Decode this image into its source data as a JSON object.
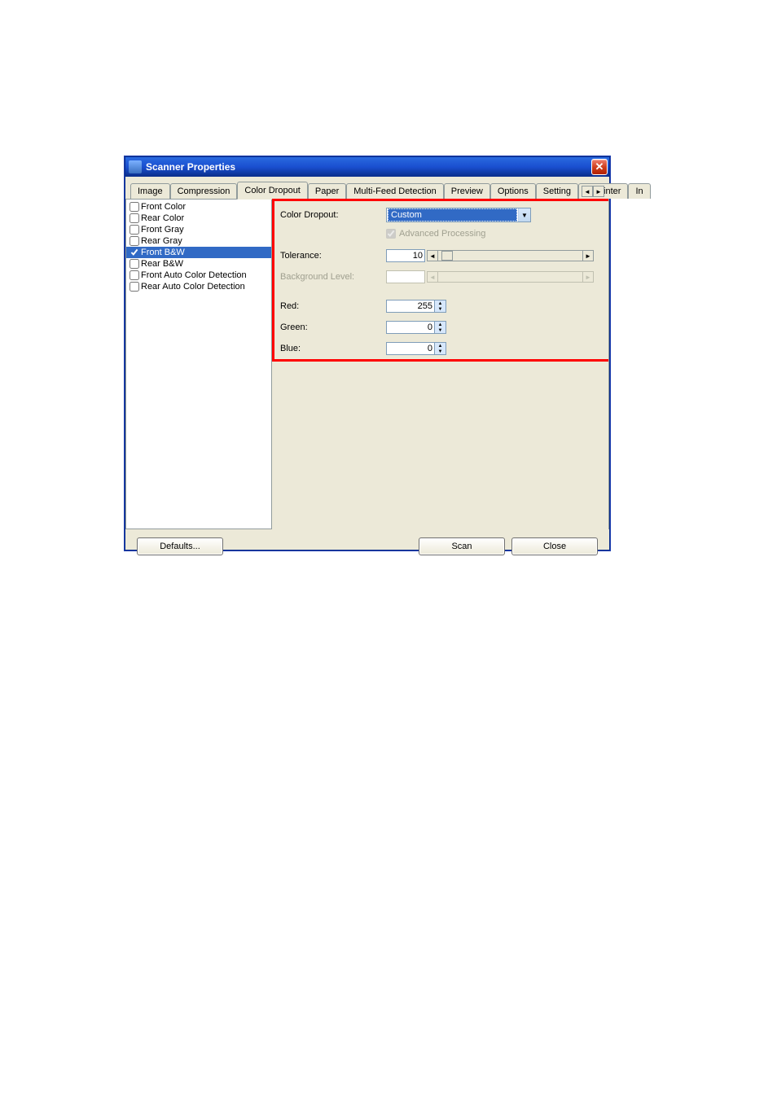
{
  "window": {
    "title": "Scanner Properties"
  },
  "tabs": {
    "items": [
      "Image",
      "Compression",
      "Color Dropout",
      "Paper",
      "Multi-Feed Detection",
      "Preview",
      "Options",
      "Setting",
      "Imprinter",
      "In"
    ],
    "activeIndex": 2
  },
  "sidebar": {
    "items": [
      {
        "label": "Front Color",
        "checked": false,
        "selected": false
      },
      {
        "label": "Rear Color",
        "checked": false,
        "selected": false
      },
      {
        "label": "Front Gray",
        "checked": false,
        "selected": false
      },
      {
        "label": "Rear Gray",
        "checked": false,
        "selected": false
      },
      {
        "label": "Front B&W",
        "checked": true,
        "selected": true
      },
      {
        "label": "Rear B&W",
        "checked": false,
        "selected": false
      },
      {
        "label": "Front Auto Color Detection",
        "checked": false,
        "selected": false
      },
      {
        "label": "Rear Auto Color Detection",
        "checked": false,
        "selected": false
      }
    ]
  },
  "form": {
    "colorDropout": {
      "label": "Color Dropout:",
      "value": "Custom"
    },
    "advancedProcessing": {
      "label": "Advanced Processing",
      "checked": true
    },
    "tolerance": {
      "label": "Tolerance:",
      "value": "10"
    },
    "backgroundLevel": {
      "label": "Background Level:",
      "value": ""
    },
    "red": {
      "label": "Red:",
      "value": "255"
    },
    "green": {
      "label": "Green:",
      "value": "0"
    },
    "blue": {
      "label": "Blue:",
      "value": "0"
    }
  },
  "buttons": {
    "defaults": "Defaults...",
    "scan": "Scan",
    "close": "Close"
  }
}
